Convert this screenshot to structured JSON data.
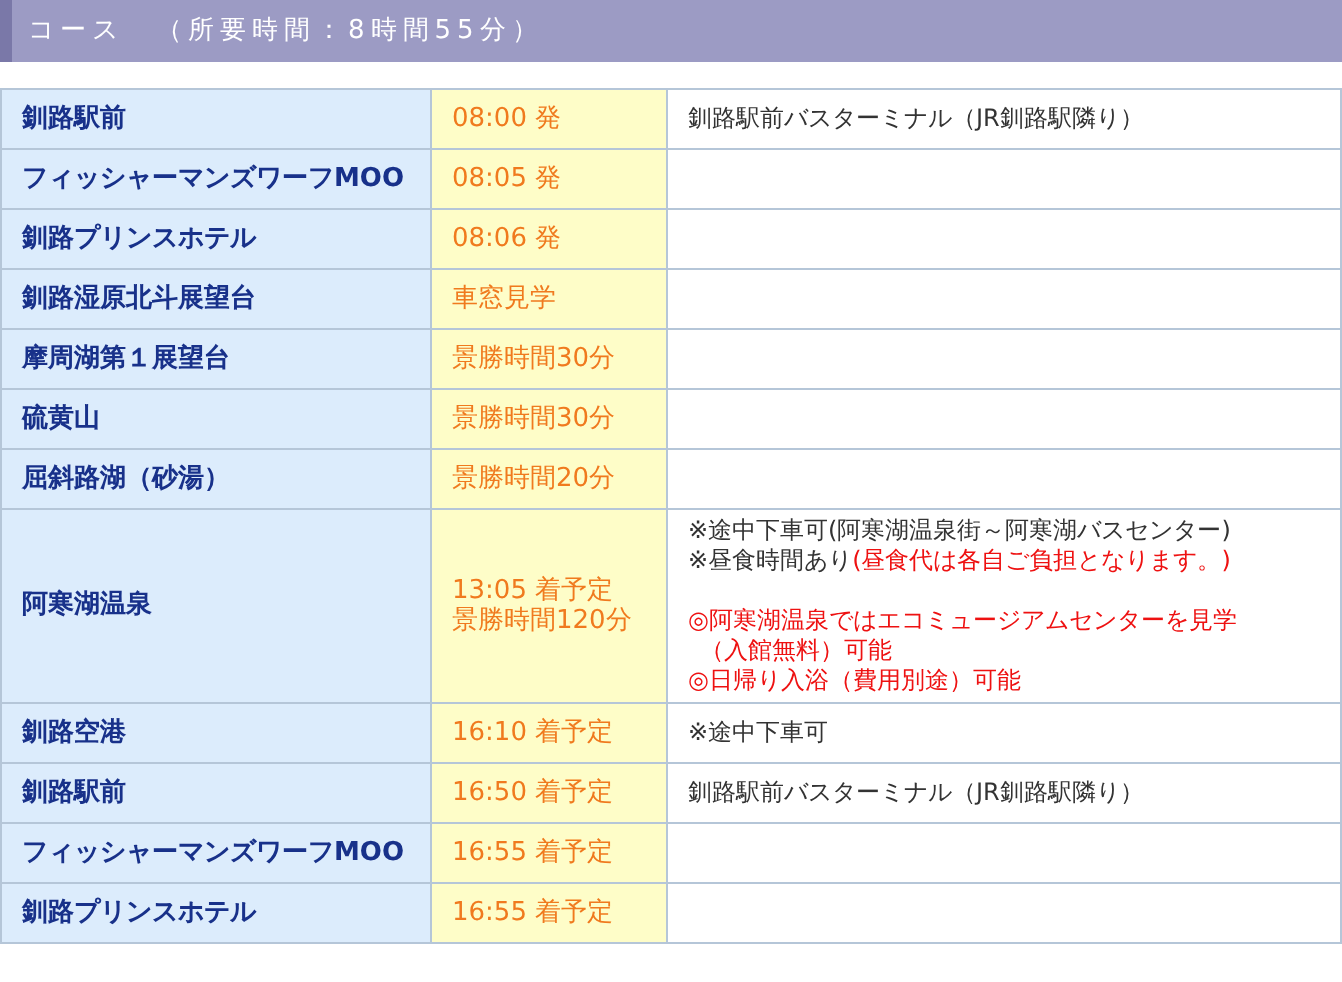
{
  "header": {
    "title": "コース　（所要時間：8時間55分）"
  },
  "rows": [
    {
      "place": "釧路駅前",
      "time": [
        "08:00 発"
      ],
      "note_groups": [
        [
          [
            {
              "text": "釧路駅前バスターミナル（JR釧路駅隣り）",
              "highlight": false
            }
          ]
        ]
      ]
    },
    {
      "place": "フィッシャーマンズワーフMOO",
      "time": [
        "08:05 発"
      ]
    },
    {
      "place": "釧路プリンスホテル",
      "time": [
        "08:06 発"
      ]
    },
    {
      "place": "釧路湿原北斗展望台",
      "time": [
        "車窓見学"
      ]
    },
    {
      "place": "摩周湖第１展望台",
      "time": [
        "景勝時間30分"
      ]
    },
    {
      "place": "硫黄山",
      "time": [
        "景勝時間30分"
      ]
    },
    {
      "place": "屈斜路湖（砂湯）",
      "time": [
        "景勝時間20分"
      ]
    },
    {
      "place": "阿寒湖温泉",
      "time": [
        "13:05 着予定",
        "景勝時間120分"
      ],
      "note_groups": [
        [
          [
            {
              "text": "※途中下車可(阿寒湖温泉街～阿寒湖バスセンター)",
              "highlight": false
            }
          ],
          [
            {
              "text": "※昼食時間あり",
              "highlight": false
            },
            {
              "text": "(昼食代は各自ご負担となります。)",
              "highlight": true
            }
          ]
        ],
        [
          [
            {
              "text": "◎阿寒湖温泉ではエコミュージアムセンターを見学",
              "highlight": true
            }
          ],
          [
            {
              "text": "（入館無料）可能",
              "highlight": true,
              "indent": true
            }
          ],
          [
            {
              "text": "◎日帰り入浴（費用別途）可能",
              "highlight": true
            }
          ]
        ]
      ]
    },
    {
      "place": "釧路空港",
      "time": [
        "16:10 着予定"
      ],
      "note_groups": [
        [
          [
            {
              "text": "※途中下車可",
              "highlight": false
            }
          ]
        ]
      ]
    },
    {
      "place": "釧路駅前",
      "time": [
        "16:50 着予定"
      ],
      "note_groups": [
        [
          [
            {
              "text": "釧路駅前バスターミナル（JR釧路駅隣り）",
              "highlight": false
            }
          ]
        ]
      ]
    },
    {
      "place": "フィッシャーマンズワーフMOO",
      "time": [
        "16:55 着予定"
      ]
    },
    {
      "place": "釧路プリンスホテル",
      "time": [
        "16:55 着予定"
      ]
    }
  ]
}
